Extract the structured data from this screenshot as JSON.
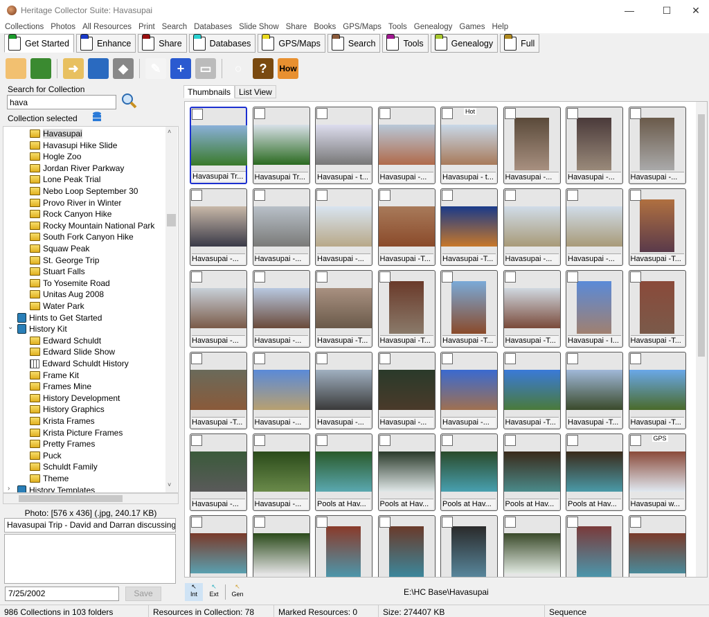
{
  "window": {
    "title": "Heritage Collector Suite: Havasupai",
    "minimize": "—",
    "maximize": "☐",
    "close": "✕"
  },
  "menu": [
    "Collections",
    "Photos",
    "All Resources",
    "Print",
    "Search",
    "Databases",
    "Slide Show",
    "Share",
    "Books",
    "GPS/Maps",
    "Tools",
    "Genealogy",
    "Games",
    "Help"
  ],
  "tabs": [
    {
      "label": "Get Started",
      "color": "#1a9a2a",
      "active": true
    },
    {
      "label": "Enhance",
      "color": "#1a3ac8"
    },
    {
      "label": "Share",
      "color": "#9a1010"
    },
    {
      "label": "Databases",
      "color": "#2ad0d0"
    },
    {
      "label": "GPS/Maps",
      "color": "#e8d820"
    },
    {
      "label": "Search",
      "color": "#8a5a3a"
    },
    {
      "label": "Tools",
      "color": "#a01890"
    },
    {
      "label": "Genealogy",
      "color": "#a8c830"
    },
    {
      "label": "Full",
      "color": "#b08a20"
    }
  ],
  "toolbar": [
    {
      "icon": "folder-icon",
      "glyph": "",
      "bg": "#f2c070"
    },
    {
      "icon": "monitor-icon",
      "glyph": "",
      "bg": "#3a8a30"
    },
    {
      "sep": true
    },
    {
      "icon": "import-icon",
      "glyph": "➜",
      "bg": "#e8c060"
    },
    {
      "icon": "phone-icon",
      "glyph": "",
      "bg": "#2a6ac0"
    },
    {
      "icon": "scanner-icon",
      "glyph": "◆",
      "bg": "#888"
    },
    {
      "sep": true
    },
    {
      "icon": "edit-icon",
      "glyph": "✎",
      "bg": "#f4f4f4"
    },
    {
      "icon": "zoom-in-icon",
      "glyph": "+",
      "bg": "#2a5ad0"
    },
    {
      "icon": "drive-icon",
      "glyph": "▭",
      "bg": "#bbb"
    },
    {
      "sep": true
    },
    {
      "icon": "magnifier-icon",
      "glyph": "○",
      "bg": "#f0f0f0"
    },
    {
      "icon": "help-icon",
      "glyph": "?",
      "bg": "#7a4a10"
    },
    {
      "icon": "how-icon",
      "glyph": "How",
      "bg": "#e89030"
    }
  ],
  "search": {
    "label": "Search for Collection",
    "value": "hava",
    "collection_label": "Collection selected"
  },
  "tree": [
    {
      "label": "Havasupai",
      "level": 2,
      "icon": "folder",
      "selected": true
    },
    {
      "label": "Havasupi Hike Slide",
      "level": 2,
      "icon": "folder"
    },
    {
      "label": "Hogle Zoo",
      "level": 2,
      "icon": "folder"
    },
    {
      "label": "Jordan River Parkway",
      "level": 2,
      "icon": "folder"
    },
    {
      "label": "Lone Peak Trial",
      "level": 2,
      "icon": "folder"
    },
    {
      "label": "Nebo Loop September 30",
      "level": 2,
      "icon": "folder"
    },
    {
      "label": "Provo River in Winter",
      "level": 2,
      "icon": "folder"
    },
    {
      "label": "Rock Canyon Hike",
      "level": 2,
      "icon": "folder"
    },
    {
      "label": "Rocky Mountain National Park",
      "level": 2,
      "icon": "folder"
    },
    {
      "label": "South Fork Canyon Hike",
      "level": 2,
      "icon": "folder"
    },
    {
      "label": "Squaw Peak",
      "level": 2,
      "icon": "folder"
    },
    {
      "label": "St. George Trip",
      "level": 2,
      "icon": "folder"
    },
    {
      "label": "Stuart Falls",
      "level": 2,
      "icon": "folder"
    },
    {
      "label": "To Yosemite Road",
      "level": 2,
      "icon": "folder"
    },
    {
      "label": "Unitas Aug 2008",
      "level": 2,
      "icon": "folder"
    },
    {
      "label": "Water Park",
      "level": 2,
      "icon": "folder"
    },
    {
      "label": "Hints to Get Started",
      "level": 1,
      "icon": "book"
    },
    {
      "label": "History Kit",
      "level": 1,
      "icon": "book",
      "expanded": true
    },
    {
      "label": "Edward Schuldt",
      "level": 2,
      "icon": "folder"
    },
    {
      "label": "Edward Slide Show",
      "level": 2,
      "icon": "folder"
    },
    {
      "label": "Edward Schuldt History",
      "level": 2,
      "icon": "book2"
    },
    {
      "label": "Frame Kit",
      "level": 2,
      "icon": "folder"
    },
    {
      "label": "Frames Mine",
      "level": 2,
      "icon": "folder"
    },
    {
      "label": "History Development",
      "level": 2,
      "icon": "folder"
    },
    {
      "label": "History Graphics",
      "level": 2,
      "icon": "folder"
    },
    {
      "label": "Krista Frames",
      "level": 2,
      "icon": "folder"
    },
    {
      "label": "Krista Picture Frames",
      "level": 2,
      "icon": "folder"
    },
    {
      "label": "Pretty Frames",
      "level": 2,
      "icon": "folder"
    },
    {
      "label": "Puck",
      "level": 2,
      "icon": "folder"
    },
    {
      "label": "Schuldt Family",
      "level": 2,
      "icon": "folder"
    },
    {
      "label": "Theme",
      "level": 2,
      "icon": "folder"
    },
    {
      "label": "History Templates",
      "level": 1,
      "icon": "book",
      "collapsed": true
    }
  ],
  "photo": {
    "info": "Photo: [576 x 436]  (.jpg,  240.17 KB)",
    "caption": "Havasupai Trip - David and Darran discussing",
    "date": "7/25/2002",
    "save": "Save"
  },
  "view_tabs": [
    "Thumbnails",
    "List View"
  ],
  "thumbnails": [
    {
      "caption": "Havasupai Tr...",
      "c": [
        "#8ab0d8",
        "#3a7a2a"
      ],
      "selected": true
    },
    {
      "caption": "Havasupai Tr...",
      "c": [
        "#d8e0e8",
        "#2a6a20"
      ]
    },
    {
      "caption": "Havasupai - t...",
      "c": [
        "#dde",
        "#777"
      ]
    },
    {
      "caption": "Havasupai -...",
      "c": [
        "#b8c8d8",
        "#b06a4a"
      ]
    },
    {
      "caption": "Havasupai - t...",
      "c": [
        "#c8d8e8",
        "#a87a5a"
      ],
      "tag": "Hot"
    },
    {
      "caption": "Havasupai -...",
      "c": [
        "#5a4a3a",
        "#a89080"
      ],
      "portrait": true
    },
    {
      "caption": "Havasupai -...",
      "c": [
        "#4a3a3a",
        "#9a8a7a"
      ],
      "portrait": true
    },
    {
      "caption": "Havasupai -...",
      "c": [
        "#6a5a4a",
        "#aaa"
      ],
      "portrait": true
    },
    {
      "caption": "Havasupai -...",
      "c": [
        "#c8b8a8",
        "#3a3a48"
      ]
    },
    {
      "caption": "Havasupai -...",
      "c": [
        "#b8c0c8",
        "#7a7a78"
      ]
    },
    {
      "caption": "Havasupai -...",
      "c": [
        "#d8e4f0",
        "#b8a888"
      ]
    },
    {
      "caption": "Havasupai -T...",
      "c": [
        "#a87a5a",
        "#8a4a2a"
      ]
    },
    {
      "caption": "Havasupai -T...",
      "c": [
        "#1a3a8a",
        "#c8782a"
      ]
    },
    {
      "caption": "Havasupai -...",
      "c": [
        "#d0dce8",
        "#a89a78"
      ]
    },
    {
      "caption": "Havasupai -...",
      "c": [
        "#d0dce8",
        "#a89a78"
      ]
    },
    {
      "caption": "Havasupai -T...",
      "c": [
        "#b07040",
        "#5a3a4a"
      ],
      "portrait": true
    },
    {
      "caption": "Havasupai -...",
      "c": [
        "#c8d0d8",
        "#7a5a48"
      ]
    },
    {
      "caption": "Havasupai -...",
      "c": [
        "#b8c8e0",
        "#6a4a3a"
      ]
    },
    {
      "caption": "Havasupai -T...",
      "c": [
        "#a89080",
        "#6a5a4a"
      ]
    },
    {
      "caption": "Havasupai -T...",
      "c": [
        "#6a3a2a",
        "#8a7a6a"
      ],
      "portrait": true
    },
    {
      "caption": "Havasupai -T...",
      "c": [
        "#7aaad8",
        "#8a4a2a"
      ],
      "portrait": true
    },
    {
      "caption": "Havasupai -T...",
      "c": [
        "#d0d8e0",
        "#7a4a3a"
      ]
    },
    {
      "caption": "Havasupai - I...",
      "c": [
        "#5a8ad8",
        "#a08070"
      ],
      "portrait": true
    },
    {
      "caption": "Havasupai -T...",
      "c": [
        "#8a4a3a",
        "#7a5a4a"
      ],
      "portrait": true
    },
    {
      "caption": "Havasupai -T...",
      "c": [
        "#6a6a5a",
        "#8a5a3a"
      ]
    },
    {
      "caption": "Havasupai -...",
      "c": [
        "#5a8ad8",
        "#b8a070"
      ]
    },
    {
      "caption": "Havasupai -...",
      "c": [
        "#a0b0c0",
        "#3a3a3a"
      ]
    },
    {
      "caption": "Havasupai -...",
      "c": [
        "#2a3a2a",
        "#4a3a2a"
      ]
    },
    {
      "caption": "Havasupai -...",
      "c": [
        "#3a6ad0",
        "#a07050"
      ]
    },
    {
      "caption": "Havasupai -T...",
      "c": [
        "#3a7ad8",
        "#4a7a3a"
      ]
    },
    {
      "caption": "Havasupai -T...",
      "c": [
        "#a0b8d8",
        "#3a4a2a"
      ]
    },
    {
      "caption": "Havasupai -T...",
      "c": [
        "#6aa8e8",
        "#4a6a2a"
      ]
    },
    {
      "caption": "Havasupai -...",
      "c": [
        "#3a5a3a",
        "#5a5a5a"
      ]
    },
    {
      "caption": "Havasupai -...",
      "c": [
        "#2a4a1a",
        "#6a8a4a"
      ]
    },
    {
      "caption": "Pools at Hav...",
      "c": [
        "#2a5a2a",
        "#5aa8b0"
      ]
    },
    {
      "caption": "Pools at Hav...",
      "c": [
        "#2a3a2a",
        "#e0e8e8"
      ]
    },
    {
      "caption": "Pools at Hav...",
      "c": [
        "#2a4a2a",
        "#48a0b0"
      ]
    },
    {
      "caption": "Pools at Hav...",
      "c": [
        "#3a2a1a",
        "#4a8a8a"
      ]
    },
    {
      "caption": "Pools at Hav...",
      "c": [
        "#3a2a1a",
        "#4a9aa8"
      ]
    },
    {
      "caption": "Havasupai w...",
      "c": [
        "#8a4a3a",
        "#e0e8f0"
      ],
      "tag": "GPS"
    },
    {
      "caption": "",
      "c": [
        "#7a3a2a",
        "#5aa0b0"
      ]
    },
    {
      "caption": "",
      "c": [
        "#2a4a1a",
        "#e0e0e0"
      ]
    },
    {
      "caption": "",
      "c": [
        "#8a3a2a",
        "#4a9ab0"
      ],
      "portrait": true
    },
    {
      "caption": "",
      "c": [
        "#6a3a2a",
        "#3a8aa0"
      ],
      "portrait": true
    },
    {
      "caption": "",
      "c": [
        "#2a2a2a",
        "#5a8aa0"
      ],
      "portrait": true
    },
    {
      "caption": "",
      "c": [
        "#3a4a2a",
        "#e0e8e0"
      ]
    },
    {
      "caption": "",
      "c": [
        "#7a3a3a",
        "#4a9ab0"
      ],
      "portrait": true
    },
    {
      "caption": "",
      "c": [
        "#7a3a2a",
        "#4a8a9a"
      ]
    }
  ],
  "bottom": {
    "buttons": [
      "Int",
      "Ext",
      "Gen"
    ],
    "path": "E:\\HC Base\\Havasupai"
  },
  "status": [
    "986 Collections in 103 folders",
    "Resources in Collection: 78",
    "Marked Resources: 0",
    "Size: 274407 KB",
    "Sequence"
  ]
}
